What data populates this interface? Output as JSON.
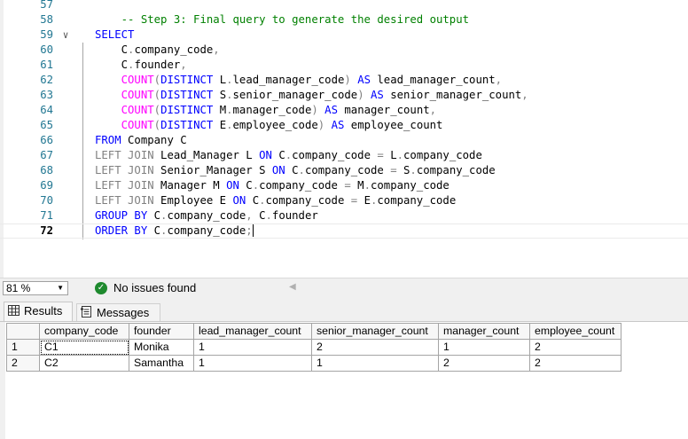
{
  "editor": {
    "caret_line_index": 15,
    "lines": [
      {
        "num": "57",
        "fold": "",
        "tokens": []
      },
      {
        "num": "58",
        "fold": "",
        "tokens": [
          {
            "t": "    "
          },
          {
            "t": "-- Step 3: Final query to generate the desired output",
            "c": "cm"
          }
        ]
      },
      {
        "num": "59",
        "fold": "∨",
        "tokens": [
          {
            "t": "SELECT",
            "c": "kw"
          }
        ]
      },
      {
        "num": "60",
        "fold": "",
        "tokens": [
          {
            "t": "    C",
            "c": "id"
          },
          {
            "t": ".",
            "c": "op"
          },
          {
            "t": "company_code",
            "c": "id"
          },
          {
            "t": ",",
            "c": "op"
          }
        ]
      },
      {
        "num": "61",
        "fold": "",
        "tokens": [
          {
            "t": "    C",
            "c": "id"
          },
          {
            "t": ".",
            "c": "op"
          },
          {
            "t": "founder",
            "c": "id"
          },
          {
            "t": ",",
            "c": "op"
          }
        ]
      },
      {
        "num": "62",
        "fold": "",
        "tokens": [
          {
            "t": "    "
          },
          {
            "t": "COUNT",
            "c": "fn"
          },
          {
            "t": "(",
            "c": "op"
          },
          {
            "t": "DISTINCT",
            "c": "kw"
          },
          {
            "t": " L",
            "c": "id"
          },
          {
            "t": ".",
            "c": "op"
          },
          {
            "t": "lead_manager_code",
            "c": "id"
          },
          {
            "t": ")",
            "c": "op"
          },
          {
            "t": " "
          },
          {
            "t": "AS",
            "c": "kw"
          },
          {
            "t": " lead_manager_count",
            "c": "id"
          },
          {
            "t": ",",
            "c": "op"
          }
        ]
      },
      {
        "num": "63",
        "fold": "",
        "tokens": [
          {
            "t": "    "
          },
          {
            "t": "COUNT",
            "c": "fn"
          },
          {
            "t": "(",
            "c": "op"
          },
          {
            "t": "DISTINCT",
            "c": "kw"
          },
          {
            "t": " S",
            "c": "id"
          },
          {
            "t": ".",
            "c": "op"
          },
          {
            "t": "senior_manager_code",
            "c": "id"
          },
          {
            "t": ")",
            "c": "op"
          },
          {
            "t": " "
          },
          {
            "t": "AS",
            "c": "kw"
          },
          {
            "t": " senior_manager_count",
            "c": "id"
          },
          {
            "t": ",",
            "c": "op"
          }
        ]
      },
      {
        "num": "64",
        "fold": "",
        "tokens": [
          {
            "t": "    "
          },
          {
            "t": "COUNT",
            "c": "fn"
          },
          {
            "t": "(",
            "c": "op"
          },
          {
            "t": "DISTINCT",
            "c": "kw"
          },
          {
            "t": " M",
            "c": "id"
          },
          {
            "t": ".",
            "c": "op"
          },
          {
            "t": "manager_code",
            "c": "id"
          },
          {
            "t": ")",
            "c": "op"
          },
          {
            "t": " "
          },
          {
            "t": "AS",
            "c": "kw"
          },
          {
            "t": " manager_count",
            "c": "id"
          },
          {
            "t": ",",
            "c": "op"
          }
        ]
      },
      {
        "num": "65",
        "fold": "",
        "tokens": [
          {
            "t": "    "
          },
          {
            "t": "COUNT",
            "c": "fn"
          },
          {
            "t": "(",
            "c": "op"
          },
          {
            "t": "DISTINCT",
            "c": "kw"
          },
          {
            "t": " E",
            "c": "id"
          },
          {
            "t": ".",
            "c": "op"
          },
          {
            "t": "employee_code",
            "c": "id"
          },
          {
            "t": ")",
            "c": "op"
          },
          {
            "t": " "
          },
          {
            "t": "AS",
            "c": "kw"
          },
          {
            "t": " employee_count",
            "c": "id"
          }
        ]
      },
      {
        "num": "66",
        "fold": "",
        "tokens": [
          {
            "t": "FROM",
            "c": "kw"
          },
          {
            "t": " Company C",
            "c": "id"
          }
        ]
      },
      {
        "num": "67",
        "fold": "",
        "tokens": [
          {
            "t": "LEFT JOIN",
            "c": "op"
          },
          {
            "t": " Lead_Manager L ",
            "c": "id"
          },
          {
            "t": "ON",
            "c": "kw"
          },
          {
            "t": " C",
            "c": "id"
          },
          {
            "t": ".",
            "c": "op"
          },
          {
            "t": "company_code ",
            "c": "id"
          },
          {
            "t": "=",
            "c": "op"
          },
          {
            "t": " L",
            "c": "id"
          },
          {
            "t": ".",
            "c": "op"
          },
          {
            "t": "company_code",
            "c": "id"
          }
        ]
      },
      {
        "num": "68",
        "fold": "",
        "tokens": [
          {
            "t": "LEFT JOIN",
            "c": "op"
          },
          {
            "t": " Senior_Manager S ",
            "c": "id"
          },
          {
            "t": "ON",
            "c": "kw"
          },
          {
            "t": " C",
            "c": "id"
          },
          {
            "t": ".",
            "c": "op"
          },
          {
            "t": "company_code ",
            "c": "id"
          },
          {
            "t": "=",
            "c": "op"
          },
          {
            "t": " S",
            "c": "id"
          },
          {
            "t": ".",
            "c": "op"
          },
          {
            "t": "company_code",
            "c": "id"
          }
        ]
      },
      {
        "num": "69",
        "fold": "",
        "tokens": [
          {
            "t": "LEFT JOIN",
            "c": "op"
          },
          {
            "t": " Manager M ",
            "c": "id"
          },
          {
            "t": "ON",
            "c": "kw"
          },
          {
            "t": " C",
            "c": "id"
          },
          {
            "t": ".",
            "c": "op"
          },
          {
            "t": "company_code ",
            "c": "id"
          },
          {
            "t": "=",
            "c": "op"
          },
          {
            "t": " M",
            "c": "id"
          },
          {
            "t": ".",
            "c": "op"
          },
          {
            "t": "company_code",
            "c": "id"
          }
        ]
      },
      {
        "num": "70",
        "fold": "",
        "tokens": [
          {
            "t": "LEFT JOIN",
            "c": "op"
          },
          {
            "t": " Employee E ",
            "c": "id"
          },
          {
            "t": "ON",
            "c": "kw"
          },
          {
            "t": " C",
            "c": "id"
          },
          {
            "t": ".",
            "c": "op"
          },
          {
            "t": "company_code ",
            "c": "id"
          },
          {
            "t": "=",
            "c": "op"
          },
          {
            "t": " E",
            "c": "id"
          },
          {
            "t": ".",
            "c": "op"
          },
          {
            "t": "company_code",
            "c": "id"
          }
        ]
      },
      {
        "num": "71",
        "fold": "",
        "tokens": [
          {
            "t": "GROUP BY",
            "c": "kw"
          },
          {
            "t": " C",
            "c": "id"
          },
          {
            "t": ".",
            "c": "op"
          },
          {
            "t": "company_code",
            "c": "id"
          },
          {
            "t": ",",
            "c": "op"
          },
          {
            "t": " C",
            "c": "id"
          },
          {
            "t": ".",
            "c": "op"
          },
          {
            "t": "founder",
            "c": "id"
          }
        ]
      },
      {
        "num": "72",
        "fold": "",
        "tokens": [
          {
            "t": "ORDER BY",
            "c": "kw"
          },
          {
            "t": " C",
            "c": "id"
          },
          {
            "t": ".",
            "c": "op"
          },
          {
            "t": "company_code",
            "c": "id"
          },
          {
            "t": ";",
            "c": "op"
          }
        ]
      }
    ]
  },
  "statusbar": {
    "zoom": "81 %",
    "issues_text": "No issues found"
  },
  "results": {
    "tabs": [
      {
        "label": "Results",
        "icon": "grid-icon",
        "active": true
      },
      {
        "label": "Messages",
        "icon": "messages-icon",
        "active": false
      }
    ],
    "columns": [
      "company_code",
      "founder",
      "lead_manager_count",
      "senior_manager_count",
      "manager_count",
      "employee_count"
    ],
    "rows": [
      {
        "rownum": "1",
        "cells": [
          "C1",
          "Monika",
          "1",
          "2",
          "1",
          "2"
        ]
      },
      {
        "rownum": "2",
        "cells": [
          "C2",
          "Samantha",
          "1",
          "1",
          "2",
          "2"
        ]
      }
    ]
  },
  "colors": {
    "keyword": "#0000ff",
    "function": "#ff00ff",
    "operator": "#808080",
    "comment": "#008000",
    "line_number": "#237893",
    "status_ok": "#1e8a2e"
  }
}
